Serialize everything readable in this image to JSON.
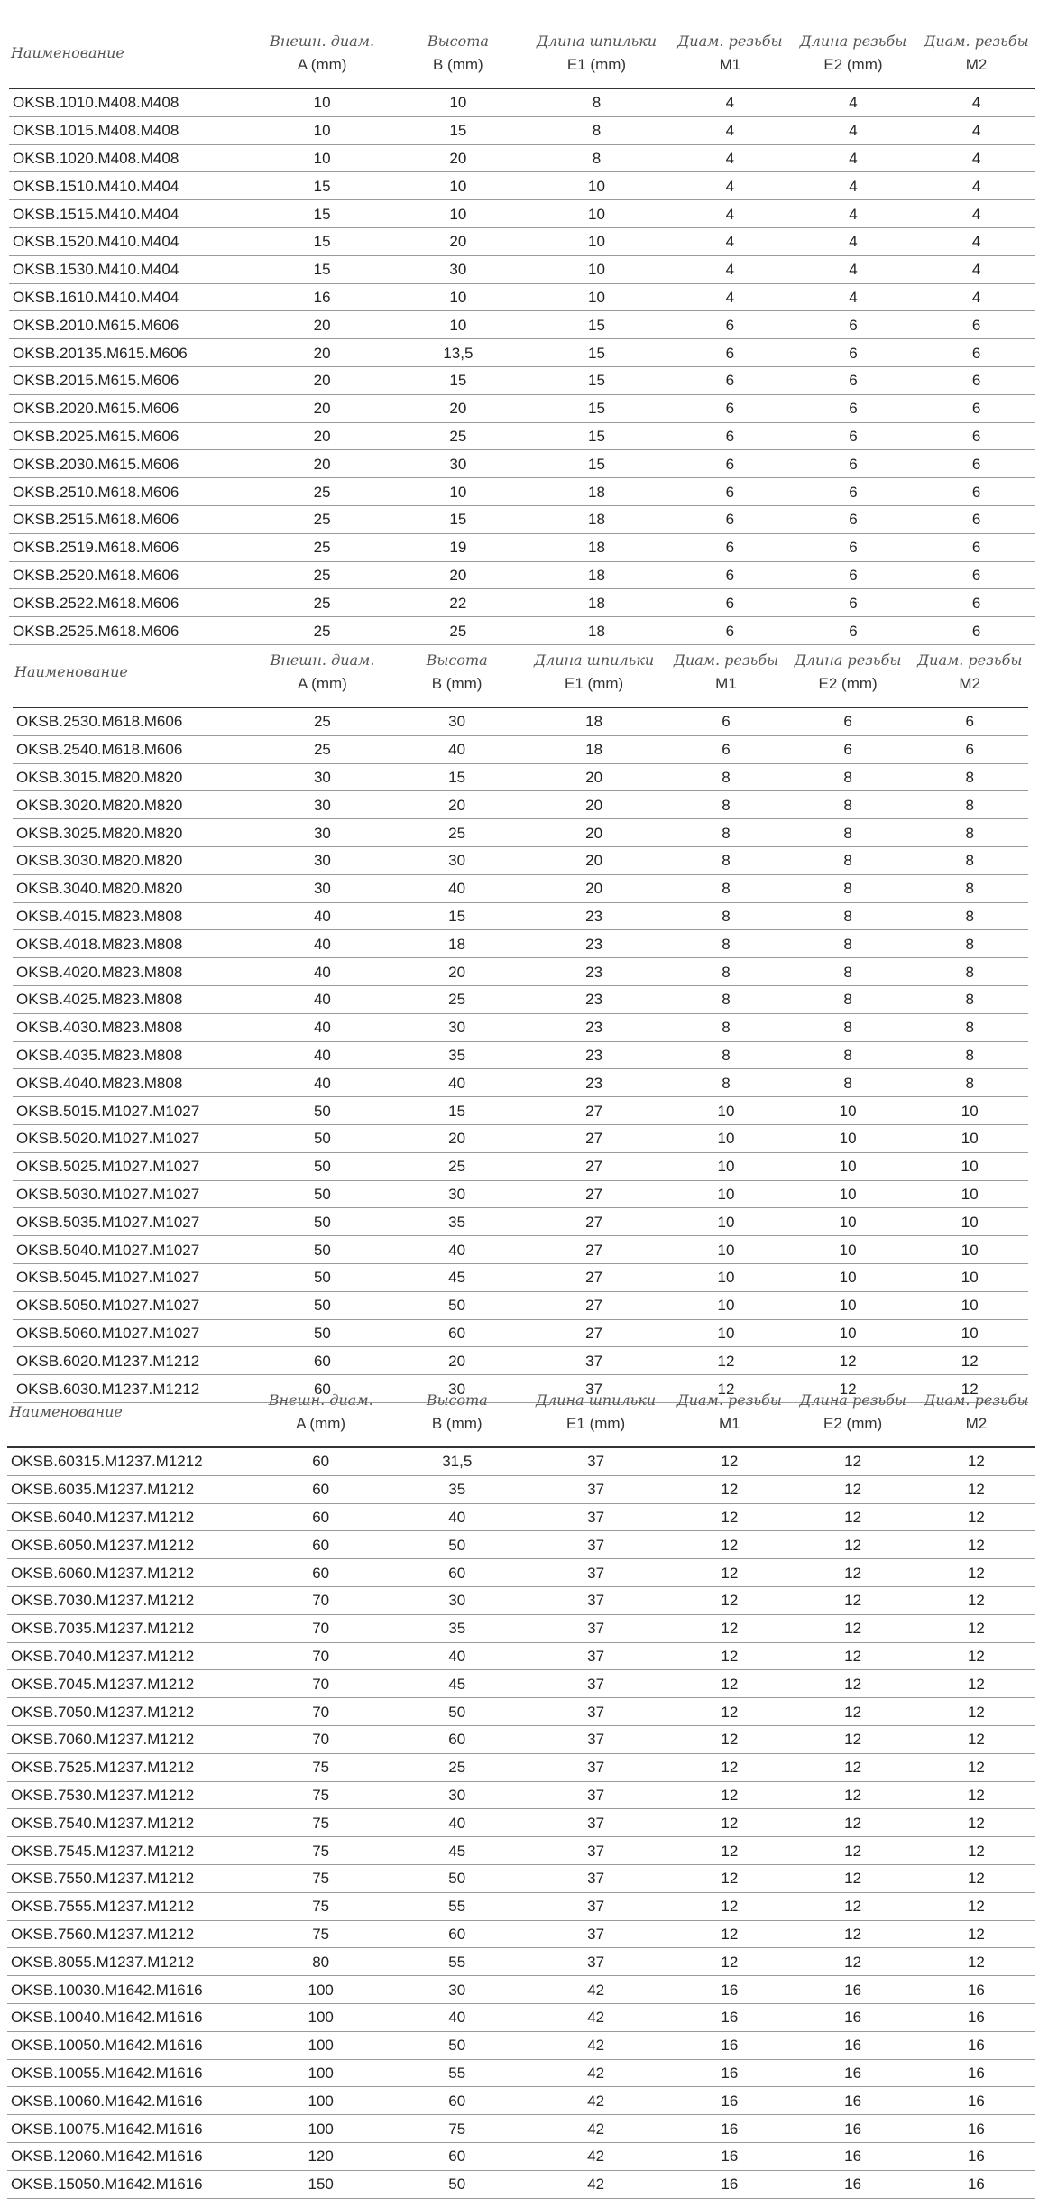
{
  "headers": {
    "name": "Наименование",
    "a": [
      "Внешн. диам.",
      "A (mm)"
    ],
    "b": [
      "Высота",
      "B (mm)"
    ],
    "e1": [
      "Длина шпильки",
      "E1 (mm)"
    ],
    "m1": [
      "Диам. резьбы",
      "M1"
    ],
    "e2": [
      "Длина резьбы",
      "E2 (mm)"
    ],
    "m2": [
      "Диам. резьбы",
      "M2"
    ]
  },
  "tables": [
    {
      "rows": [
        [
          "OKSB.1010.M408.M408",
          "10",
          "10",
          "8",
          "4",
          "4",
          "4"
        ],
        [
          "OKSB.1015.M408.M408",
          "10",
          "15",
          "8",
          "4",
          "4",
          "4"
        ],
        [
          "OKSB.1020.M408.M408",
          "10",
          "20",
          "8",
          "4",
          "4",
          "4"
        ],
        [
          "OKSB.1510.M410.M404",
          "15",
          "10",
          "10",
          "4",
          "4",
          "4"
        ],
        [
          "OKSB.1515.M410.M404",
          "15",
          "10",
          "10",
          "4",
          "4",
          "4"
        ],
        [
          "OKSB.1520.M410.M404",
          "15",
          "20",
          "10",
          "4",
          "4",
          "4"
        ],
        [
          "OKSB.1530.M410.M404",
          "15",
          "30",
          "10",
          "4",
          "4",
          "4"
        ],
        [
          "OKSB.1610.M410.M404",
          "16",
          "10",
          "10",
          "4",
          "4",
          "4"
        ],
        [
          "OKSB.2010.M615.M606",
          "20",
          "10",
          "15",
          "6",
          "6",
          "6"
        ],
        [
          "OKSB.20135.M615.M606",
          "20",
          "13,5",
          "15",
          "6",
          "6",
          "6"
        ],
        [
          "OKSB.2015.M615.M606",
          "20",
          "15",
          "15",
          "6",
          "6",
          "6"
        ],
        [
          "OKSB.2020.M615.M606",
          "20",
          "20",
          "15",
          "6",
          "6",
          "6"
        ],
        [
          "OKSB.2025.M615.M606",
          "20",
          "25",
          "15",
          "6",
          "6",
          "6"
        ],
        [
          "OKSB.2030.M615.M606",
          "20",
          "30",
          "15",
          "6",
          "6",
          "6"
        ],
        [
          "OKSB.2510.M618.M606",
          "25",
          "10",
          "18",
          "6",
          "6",
          "6"
        ],
        [
          "OKSB.2515.M618.M606",
          "25",
          "15",
          "18",
          "6",
          "6",
          "6"
        ],
        [
          "OKSB.2519.M618.M606",
          "25",
          "19",
          "18",
          "6",
          "6",
          "6"
        ],
        [
          "OKSB.2520.M618.M606",
          "25",
          "20",
          "18",
          "6",
          "6",
          "6"
        ],
        [
          "OKSB.2522.M618.M606",
          "25",
          "22",
          "18",
          "6",
          "6",
          "6"
        ],
        [
          "OKSB.2525.M618.M606",
          "25",
          "25",
          "18",
          "6",
          "6",
          "6"
        ]
      ]
    },
    {
      "rows": [
        [
          "OKSB.2530.M618.M606",
          "25",
          "30",
          "18",
          "6",
          "6",
          "6"
        ],
        [
          "OKSB.2540.M618.M606",
          "25",
          "40",
          "18",
          "6",
          "6",
          "6"
        ],
        [
          "OKSB.3015.M820.M820",
          "30",
          "15",
          "20",
          "8",
          "8",
          "8"
        ],
        [
          "OKSB.3020.M820.M820",
          "30",
          "20",
          "20",
          "8",
          "8",
          "8"
        ],
        [
          "OKSB.3025.M820.M820",
          "30",
          "25",
          "20",
          "8",
          "8",
          "8"
        ],
        [
          "OKSB.3030.M820.M820",
          "30",
          "30",
          "20",
          "8",
          "8",
          "8"
        ],
        [
          "OKSB.3040.M820.M820",
          "30",
          "40",
          "20",
          "8",
          "8",
          "8"
        ],
        [
          "OKSB.4015.M823.M808",
          "40",
          "15",
          "23",
          "8",
          "8",
          "8"
        ],
        [
          "OKSB.4018.M823.M808",
          "40",
          "18",
          "23",
          "8",
          "8",
          "8"
        ],
        [
          "OKSB.4020.M823.M808",
          "40",
          "20",
          "23",
          "8",
          "8",
          "8"
        ],
        [
          "OKSB.4025.M823.M808",
          "40",
          "25",
          "23",
          "8",
          "8",
          "8"
        ],
        [
          "OKSB.4030.M823.M808",
          "40",
          "30",
          "23",
          "8",
          "8",
          "8"
        ],
        [
          "OKSB.4035.M823.M808",
          "40",
          "35",
          "23",
          "8",
          "8",
          "8"
        ],
        [
          "OKSB.4040.M823.M808",
          "40",
          "40",
          "23",
          "8",
          "8",
          "8"
        ],
        [
          "OKSB.5015.M1027.M1027",
          "50",
          "15",
          "27",
          "10",
          "10",
          "10"
        ],
        [
          "OKSB.5020.M1027.M1027",
          "50",
          "20",
          "27",
          "10",
          "10",
          "10"
        ],
        [
          "OKSB.5025.M1027.M1027",
          "50",
          "25",
          "27",
          "10",
          "10",
          "10"
        ],
        [
          "OKSB.5030.M1027.M1027",
          "50",
          "30",
          "27",
          "10",
          "10",
          "10"
        ],
        [
          "OKSB.5035.M1027.M1027",
          "50",
          "35",
          "27",
          "10",
          "10",
          "10"
        ],
        [
          "OKSB.5040.M1027.M1027",
          "50",
          "40",
          "27",
          "10",
          "10",
          "10"
        ],
        [
          "OKSB.5045.M1027.M1027",
          "50",
          "45",
          "27",
          "10",
          "10",
          "10"
        ],
        [
          "OKSB.5050.M1027.M1027",
          "50",
          "50",
          "27",
          "10",
          "10",
          "10"
        ],
        [
          "OKSB.5060.M1027.M1027",
          "50",
          "60",
          "27",
          "10",
          "10",
          "10"
        ],
        [
          "OKSB.6020.M1237.M1212",
          "60",
          "20",
          "37",
          "12",
          "12",
          "12"
        ],
        [
          "OKSB.6030.M1237.M1212",
          "60",
          "30",
          "37",
          "12",
          "12",
          "12"
        ]
      ]
    },
    {
      "rows": [
        [
          "OKSB.60315.M1237.M1212",
          "60",
          "31,5",
          "37",
          "12",
          "12",
          "12"
        ],
        [
          "OKSB.6035.M1237.M1212",
          "60",
          "35",
          "37",
          "12",
          "12",
          "12"
        ],
        [
          "OKSB.6040.M1237.M1212",
          "60",
          "40",
          "37",
          "12",
          "12",
          "12"
        ],
        [
          "OKSB.6050.M1237.M1212",
          "60",
          "50",
          "37",
          "12",
          "12",
          "12"
        ],
        [
          "OKSB.6060.M1237.M1212",
          "60",
          "60",
          "37",
          "12",
          "12",
          "12"
        ],
        [
          "OKSB.7030.M1237.M1212",
          "70",
          "30",
          "37",
          "12",
          "12",
          "12"
        ],
        [
          "OKSB.7035.M1237.M1212",
          "70",
          "35",
          "37",
          "12",
          "12",
          "12"
        ],
        [
          "OKSB.7040.M1237.M1212",
          "70",
          "40",
          "37",
          "12",
          "12",
          "12"
        ],
        [
          "OKSB.7045.M1237.M1212",
          "70",
          "45",
          "37",
          "12",
          "12",
          "12"
        ],
        [
          "OKSB.7050.M1237.M1212",
          "70",
          "50",
          "37",
          "12",
          "12",
          "12"
        ],
        [
          "OKSB.7060.M1237.M1212",
          "70",
          "60",
          "37",
          "12",
          "12",
          "12"
        ],
        [
          "OKSB.7525.M1237.M1212",
          "75",
          "25",
          "37",
          "12",
          "12",
          "12"
        ],
        [
          "OKSB.7530.M1237.M1212",
          "75",
          "30",
          "37",
          "12",
          "12",
          "12"
        ],
        [
          "OKSB.7540.M1237.M1212",
          "75",
          "40",
          "37",
          "12",
          "12",
          "12"
        ],
        [
          "OKSB.7545.M1237.M1212",
          "75",
          "45",
          "37",
          "12",
          "12",
          "12"
        ],
        [
          "OKSB.7550.M1237.M1212",
          "75",
          "50",
          "37",
          "12",
          "12",
          "12"
        ],
        [
          "OKSB.7555.M1237.M1212",
          "75",
          "55",
          "37",
          "12",
          "12",
          "12"
        ],
        [
          "OKSB.7560.M1237.M1212",
          "75",
          "60",
          "37",
          "12",
          "12",
          "12"
        ],
        [
          "OKSB.8055.M1237.M1212",
          "80",
          "55",
          "37",
          "12",
          "12",
          "12"
        ],
        [
          "OKSB.10030.M1642.M1616",
          "100",
          "30",
          "42",
          "16",
          "16",
          "16"
        ],
        [
          "OKSB.10040.M1642.M1616",
          "100",
          "40",
          "42",
          "16",
          "16",
          "16"
        ],
        [
          "OKSB.10050.M1642.M1616",
          "100",
          "50",
          "42",
          "16",
          "16",
          "16"
        ],
        [
          "OKSB.10055.M1642.M1616",
          "100",
          "55",
          "42",
          "16",
          "16",
          "16"
        ],
        [
          "OKSB.10060.M1642.M1616",
          "100",
          "60",
          "42",
          "16",
          "16",
          "16"
        ],
        [
          "OKSB.10075.M1642.M1616",
          "100",
          "75",
          "42",
          "16",
          "16",
          "16"
        ],
        [
          "OKSB.12060.M1642.M1616",
          "120",
          "60",
          "42",
          "16",
          "16",
          "16"
        ],
        [
          "OKSB.15050.M1642.M1616",
          "150",
          "50",
          "42",
          "16",
          "16",
          "16"
        ]
      ]
    }
  ]
}
